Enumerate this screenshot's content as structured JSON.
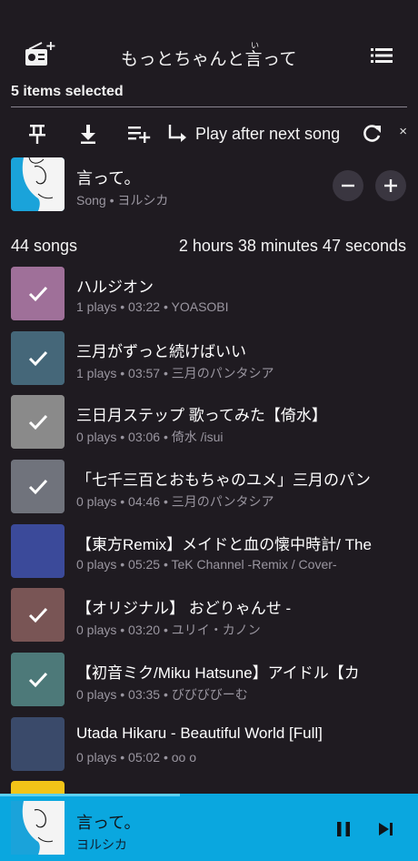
{
  "header": {
    "title": "もっとちゃんと言って",
    "ruby": "い",
    "radio_icon": "radio-add-icon",
    "queue_icon": "queue-list-icon"
  },
  "selection": {
    "label": "5 items selected",
    "actions": {
      "pin_icon": "pin-icon",
      "download_icon": "download-icon",
      "add_to_playlist_icon": "playlist-add-icon",
      "play_next_icon": "play-next-icon",
      "play_next_label": "Play after next song",
      "refresh_icon": "refresh-icon",
      "close": "×"
    }
  },
  "current": {
    "title": "言って。",
    "subtitle": "Song • ヨルシカ",
    "minus_icon": "minus-icon",
    "plus_icon": "plus-icon"
  },
  "summary": {
    "songs": "44 songs",
    "duration": "2 hours 38 minutes 47 seconds"
  },
  "songs": [
    {
      "title": "ハルジオン",
      "meta": "1 plays • 03:22 • YOASOBI",
      "selected": true,
      "color": "#c06bb5"
    },
    {
      "title": "三月がずっと続けばいい",
      "meta": "1 plays • 03:57 • 三月のパンタシア",
      "selected": true,
      "color": "#1d5a7a"
    },
    {
      "title": "三日月ステップ 歌ってみた【倚水】",
      "meta": "0 plays • 03:06 • 倚水 /isui",
      "selected": true,
      "color": "#9a9a9a"
    },
    {
      "title": "「七千三百とおもちゃのユメ」三月のパン",
      "meta": "0 plays • 04:46 • 三月のパンタシア",
      "selected": true,
      "color": "#6a6f80"
    },
    {
      "title": "【東方Remix】メイドと血の懐中時計/ The",
      "meta": "0 plays • 05:25 • TeK Channel -Remix / Cover-",
      "selected": false,
      "color": "#3b4a9a"
    },
    {
      "title": "【オリジナル】 おどりゃんせ -",
      "meta": "0 plays • 03:20 • ユリイ・カノン",
      "selected": true,
      "color": "#7a3a3a"
    },
    {
      "title": "【初音ミク/Miku Hatsune】アイドル【カ",
      "meta": "0 plays • 03:35 • びびびびーむ",
      "selected": true,
      "color": "#2a7a7a"
    },
    {
      "title": "Utada Hikaru - Beautiful World [Full]",
      "meta": "0 plays • 05:02 • oo o",
      "selected": false,
      "color": "#3a4a6a"
    }
  ],
  "player": {
    "title": "言って。",
    "artist": "ヨルシカ",
    "progress": 0.43,
    "pause_icon": "pause-icon",
    "next_icon": "skip-next-icon"
  }
}
